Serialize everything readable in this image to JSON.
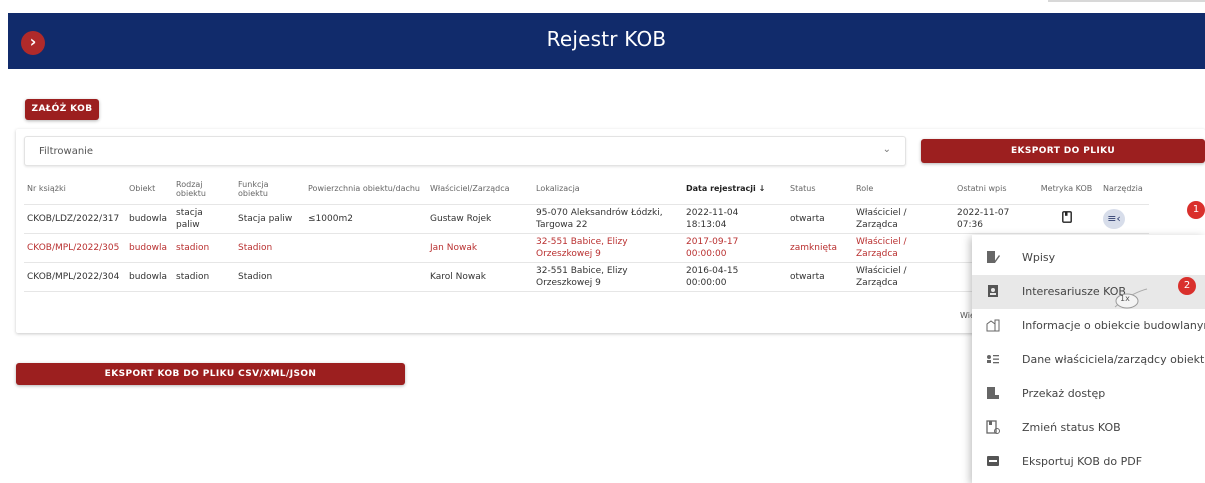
{
  "header": {
    "title": "Rejestr KOB",
    "toggle_icon": "chevron-right-icon"
  },
  "buttons": {
    "create": "ZAŁÓŻ KOB",
    "export_file": "EKSPORT DO PLIKU",
    "export_csv": "EKSPORT KOB DO PLIKU CSV/XML/JSON"
  },
  "filter": {
    "label": "Filtrowanie",
    "icon": "chevron-down-icon"
  },
  "table": {
    "columns": [
      "Nr książki",
      "Obiekt",
      "Rodzaj obiektu",
      "Funkcja obiektu",
      "Powierzchnia obiektu/dachu",
      "Właściciel/Zarządca",
      "Lokalizacja",
      "Data rejestracji",
      "Status",
      "Role",
      "Ostatni wpis",
      "Metryka KOB",
      "Narzędzia"
    ],
    "sorted_column_arrow": "↓",
    "rows": [
      {
        "nr": "CKOB/LDZ/2022/317",
        "obiekt": "budowla",
        "rodzaj": "stacja paliw",
        "funkcja": "Stacja paliw",
        "powierzchnia": "≤1000m2",
        "wlasciciel": "Gustaw Rojek",
        "lokalizacja": "95-070 Aleksandrów Łódzki, Targowa 22",
        "data": "2022-11-04 18:13:04",
        "status": "otwarta",
        "role": "Właściciel / Zarządca",
        "ostatni": "2022-11-07 07:36",
        "highlight": false
      },
      {
        "nr": "CKOB/MPL/2022/305",
        "obiekt": "budowla",
        "rodzaj": "stadion",
        "funkcja": "Stadion",
        "powierzchnia": "",
        "wlasciciel": "Jan Nowak",
        "lokalizacja": "32-551 Babice, Elizy Orzeszkowej 9",
        "data": "2017-09-17 00:00:00",
        "status": "zamknięta",
        "role": "Właściciel / Zarządca",
        "ostatni": "",
        "highlight": true
      },
      {
        "nr": "CKOB/MPL/2022/304",
        "obiekt": "budowla",
        "rodzaj": "stadion",
        "funkcja": "Stadion",
        "powierzchnia": "",
        "wlasciciel": "Karol Nowak",
        "lokalizacja": "32-551 Babice, Elizy Orzeszkowej 9",
        "data": "2016-04-15 00:00:00",
        "status": "otwarta",
        "role": "Właściciel / Zarządca",
        "ostatni": "",
        "highlight": false
      }
    ],
    "pagination_fragment": "Wie"
  },
  "menu": {
    "items": [
      {
        "label": "Wpisy",
        "icon": "book-edit-icon"
      },
      {
        "label": "Interesariusze KOB",
        "icon": "book-people-icon"
      },
      {
        "label": "Informacje o obiekcie budowlanym",
        "icon": "building-icon"
      },
      {
        "label": "Dane właściciela/zarządcy obiektu",
        "icon": "owner-list-icon"
      },
      {
        "label": "Przekaż dostęp",
        "icon": "book-share-icon"
      },
      {
        "label": "Zmień status KOB",
        "icon": "status-change-icon"
      },
      {
        "label": "Eksportuj KOB do PDF",
        "icon": "pdf-icon"
      }
    ],
    "hover_index": 1
  },
  "annotations": {
    "step1": "1",
    "step2": "2",
    "click": "1x"
  },
  "colors": {
    "header": "#112b6b",
    "accent_red": "#9c1f1f",
    "highlight_red": "#b93030",
    "badge_red": "#d9302c"
  }
}
